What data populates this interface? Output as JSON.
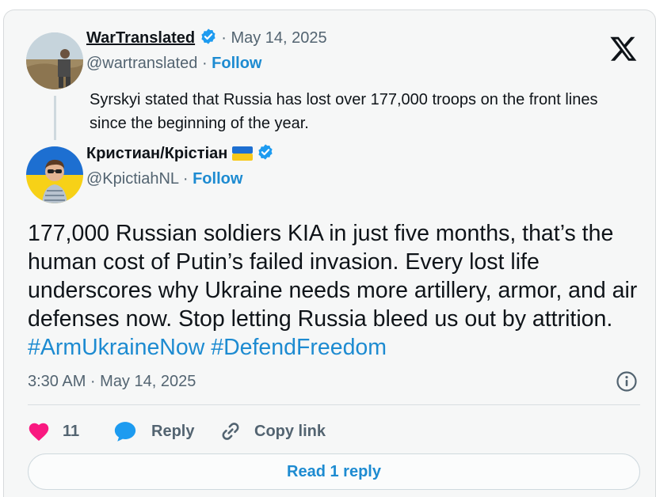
{
  "quoted_post": {
    "author_name": "WarTranslated",
    "separator": "·",
    "date": "May 14, 2025",
    "handle": "@wartranslated",
    "follow_label": "Follow",
    "text": "Syrskyi stated that Russia has lost over 177,000 troops on the front lines since the beginning of the year."
  },
  "post": {
    "author_name": "Кристиан/Крістіан",
    "flag_icon": "ukraine-flag-icon",
    "handle": "@KpictiahNL",
    "separator": "·",
    "follow_label": "Follow",
    "text": "177,000 Russian soldiers KIA in just five months, that’s the human cost of Putin’s failed invasion. Every lost life underscores why Ukraine needs more artillery, armor, and air defenses now. Stop letting Russia bleed us out by attrition.",
    "hashtags": [
      "#ArmUkraineNow",
      "#DefendFreedom"
    ],
    "timestamp": "3:30 AM · May 14, 2025"
  },
  "actions": {
    "like_count": "11",
    "reply_label": "Reply",
    "copy_link_label": "Copy link",
    "read_replies_label": "Read 1 reply"
  },
  "icons": {
    "logo": "x-logo-icon",
    "verified": "verified-badge-icon",
    "info": "info-icon",
    "heart": "heart-icon",
    "reply": "reply-bubble-icon",
    "link": "link-icon"
  },
  "colors": {
    "accent": "#1d8bd1",
    "like": "#f91880",
    "verified": "#1d9bf0",
    "muted": "#536471"
  }
}
